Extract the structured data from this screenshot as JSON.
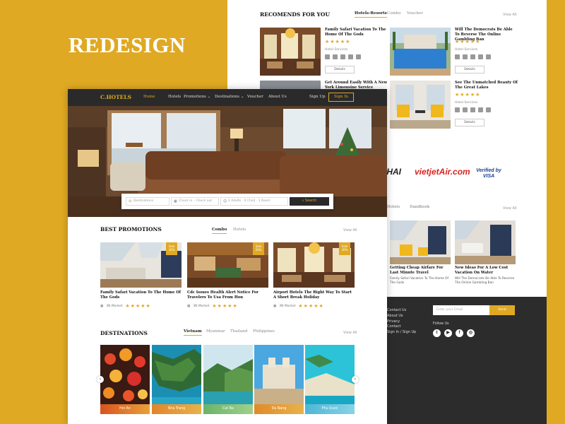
{
  "headline": "REDESIGN",
  "colors": {
    "brand": "#e0a923",
    "dark": "#2a2a2a",
    "background": "#e0a923"
  },
  "recommends": {
    "title": "RECOMENDS FOR YOU",
    "tabs": [
      "Hotels-Resorts",
      "Combo",
      "Voucher"
    ],
    "view_all": "View All",
    "cards": [
      {
        "name": "Family Safari Vacation To The Home Of The Gods",
        "services": "Hotel Services",
        "details": "Details",
        "rating": 5
      },
      {
        "name": "Will The Democrats Be Able To Reverse The Online Gambling Ban",
        "services": "Hotel Services",
        "details": "Details",
        "rating": 5
      },
      {
        "name": "Get Around Easily With A New York Limousine Service",
        "services": "Hotel Services",
        "details": "Details",
        "rating": 5
      },
      {
        "name": "See The Unmatched Beauty Of The Great Lakes",
        "services": "Hotel Services",
        "details": "Details",
        "rating": 5
      }
    ]
  },
  "partners": [
    "THAI",
    "vietjetAir.com",
    "Verified by VISA"
  ],
  "back_tabs": [
    "Hotels",
    "Dandbook"
  ],
  "back_view_all": "View All",
  "back_promos": [
    {
      "title": "Getting Cheap Airfare For Last Minute Travel",
      "sub": "Family Safari Vacation To The Home Of The Gods"
    },
    {
      "title": "New Ideas For A Low Cost Vacation On Water",
      "sub": "Will The Democrats Be Able To Reverse The Online Gambling Ban"
    }
  ],
  "footer": {
    "links": [
      "Contact Us",
      "About Us",
      "Privacy",
      "Contact",
      "Sign In / Sign Up"
    ],
    "email_placeholder": "Enter your Email",
    "send": "Send",
    "follow": "Follow Us",
    "social_icons": [
      "twitter-icon",
      "youtube-icon",
      "facebook-icon",
      "instagram-icon"
    ]
  },
  "nav": {
    "logo": "C.HOTELS",
    "items": [
      "Home",
      "Hotels",
      "Promotions",
      "Destinations",
      "Voucher",
      "About Us"
    ],
    "signup": "Sign Up",
    "signin": "Sign In"
  },
  "search": {
    "destination": "Destinations",
    "dates": "Check in – Check out",
    "guests": "2 Adults · 0 Child · 1 Room",
    "button": "Search"
  },
  "promotions": {
    "title": "BEST PROMOTIONS",
    "tabs": [
      "Combo",
      "Hotels"
    ],
    "view_all": "View All",
    "sale_label": "Sale 30%",
    "cards": [
      {
        "title": "Family Safari Vacation To The Home Of The Gods",
        "meta": "3N Market",
        "rating": 5
      },
      {
        "title": "Cdc Issues Health Alert Notice For Travelers To Usa From Hon",
        "meta": "3N Market",
        "rating": 5
      },
      {
        "title": "Airport Hotels The Right Way To Start A Short Break Holiday",
        "meta": "3N Market",
        "rating": 5
      }
    ]
  },
  "destinations": {
    "title": "DESTINATIONS",
    "tabs": [
      "Vietnam",
      "Myanmar",
      "Thailand",
      "Philippines"
    ],
    "view_all": "View All",
    "cards": [
      "Hoi An",
      "Nha Trang",
      "Cat Ba",
      "Da Nang",
      "Phu Quoc"
    ]
  }
}
